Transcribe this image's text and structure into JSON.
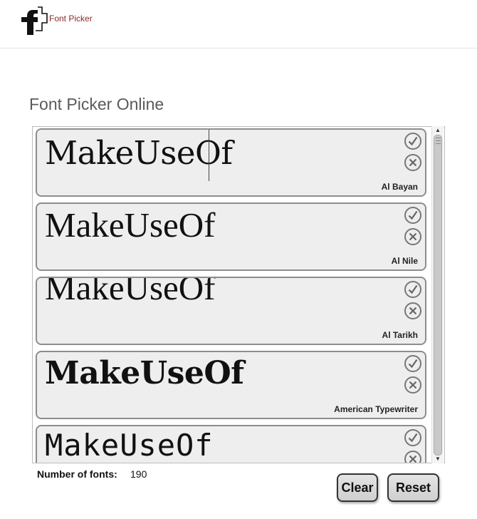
{
  "header": {
    "app_name": "Font Picker"
  },
  "page": {
    "title": "Font Picker Online"
  },
  "font_list": {
    "items": [
      {
        "sample": "MakeUseOf",
        "font_name": "Al Bayan"
      },
      {
        "sample": "MakeUseOf",
        "font_name": "Al Nile"
      },
      {
        "sample": "MakeUseOf",
        "font_name": "Al Tarikh"
      },
      {
        "sample": "MakeUseOf",
        "font_name": "American Typewriter"
      },
      {
        "sample": "MakeUseOf",
        "font_name": ""
      }
    ]
  },
  "footer": {
    "count_label": "Number of fonts:",
    "count_value": "190",
    "clear_label": "Clear",
    "reset_label": "Reset"
  },
  "icons": {
    "logo": "font-picker-logo",
    "accept": "check-circle-icon",
    "reject": "x-circle-icon"
  },
  "colors": {
    "brand_text": "#8a2a2a",
    "card_background": "#eeeeee",
    "card_border": "#8d8d8d"
  }
}
